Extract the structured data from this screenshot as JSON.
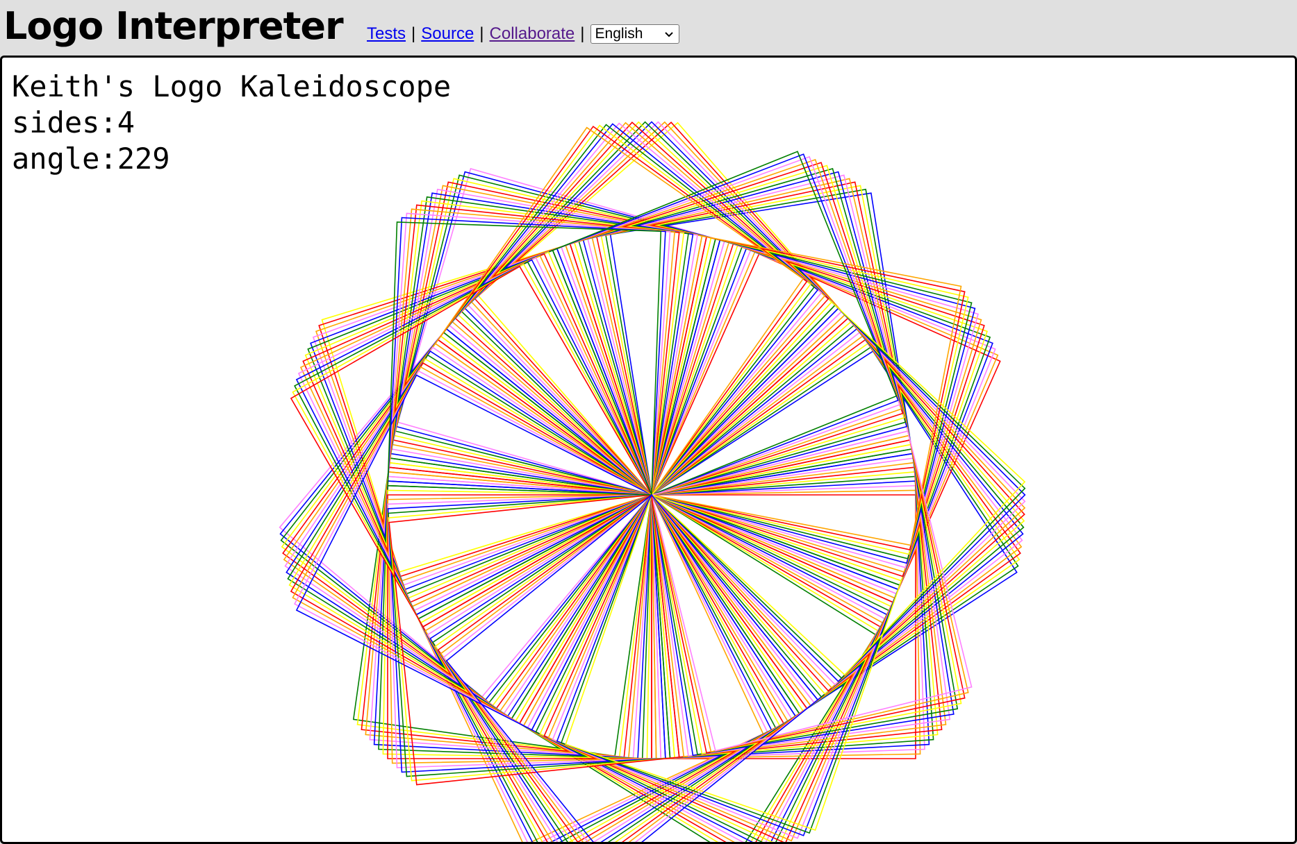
{
  "header": {
    "app_title": "Logo Interpreter",
    "nav_links": [
      "Tests",
      "Source",
      "Collaborate"
    ],
    "separator": "|",
    "language_selected": "English"
  },
  "canvas": {
    "text_lines": [
      "Keith's Logo Kaleidoscope",
      "sides:4",
      "angle:229"
    ],
    "colors": [
      "#ff0000",
      "#ffff00",
      "#008000",
      "#0000ff",
      "#ff80ff",
      "#ffa500"
    ]
  }
}
